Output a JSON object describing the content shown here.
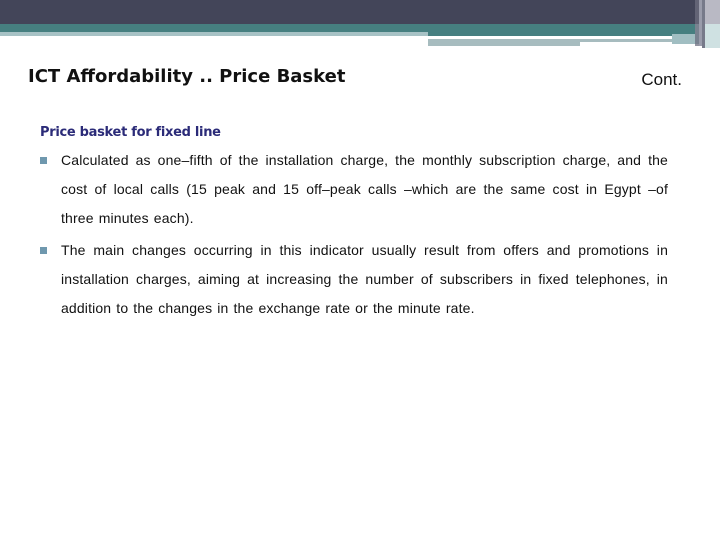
{
  "slide": {
    "title": "ICT Affordability .. Price Basket",
    "continuation_label": "Cont.",
    "section_heading": "Price basket for fixed line",
    "bullets": [
      {
        "icon": "square-bullet-icon",
        "text": "Calculated as one–fifth of the installation charge, the monthly subscription charge, and the cost of local calls (15 peak and 15 off–peak calls –which are the same cost in Egypt –of three minutes each)."
      },
      {
        "icon": "square-bullet-icon",
        "text": "The main changes occurring in this indicator usually result from offers and promotions in installation charges, aiming at increasing the number of subscribers in fixed telephones, in addition to the changes in the exchange rate or the minute rate."
      }
    ]
  },
  "theme": {
    "header_dark": "#434559",
    "header_teal": "#467f80",
    "header_light": "#a7c2c5",
    "heading_color": "#2b2b78",
    "bullet_color": "#6f98ae",
    "text_color": "#111111"
  }
}
